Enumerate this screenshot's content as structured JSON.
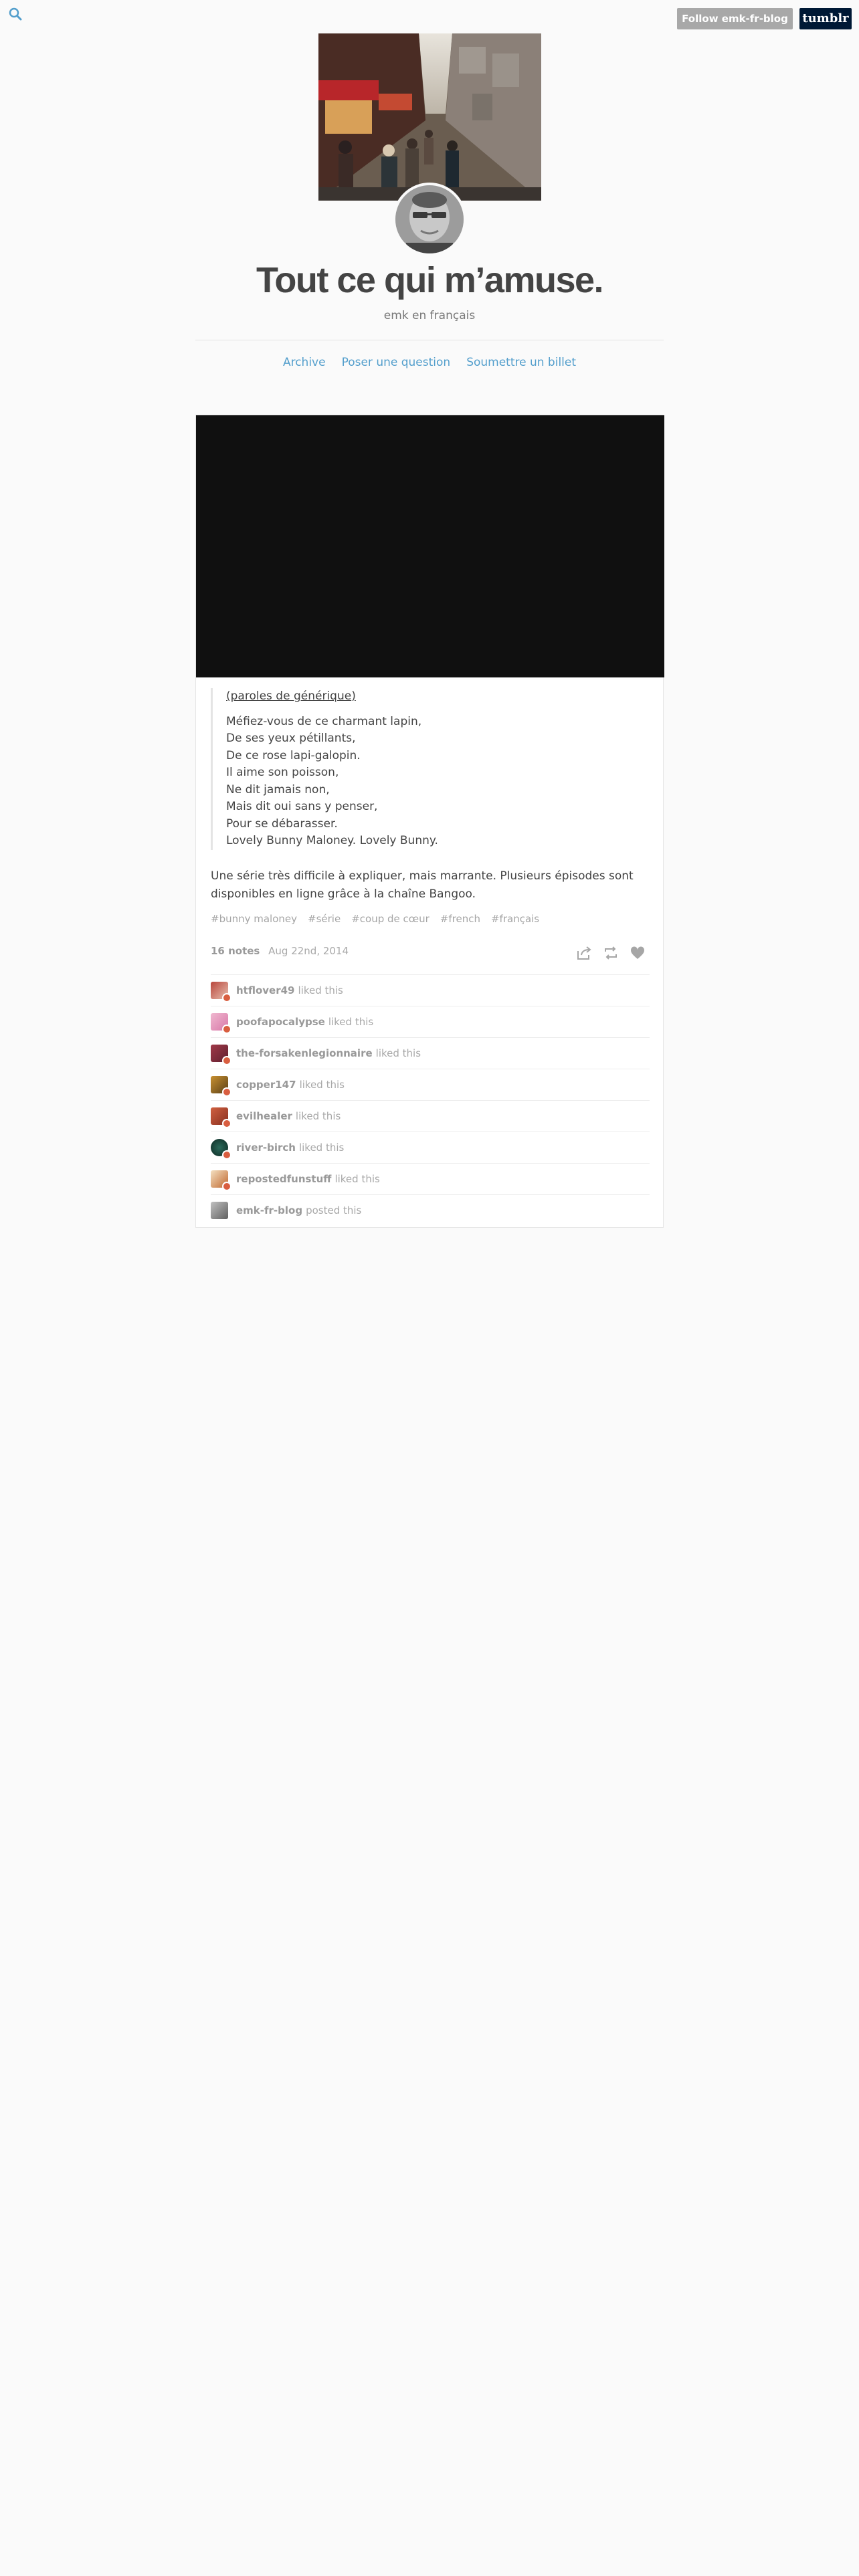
{
  "top": {
    "follow_label": "Follow emk-fr-blog",
    "tumblr_label": "tumblr"
  },
  "header": {
    "title": "Tout ce qui m’amuse.",
    "description": "emk en français"
  },
  "nav": {
    "items": [
      {
        "label": "Archive"
      },
      {
        "label": "Poser une question"
      },
      {
        "label": "Soumettre un billet"
      }
    ]
  },
  "post": {
    "quote_source": "paroles de générique",
    "quote_lines": [
      "Méfiez-vous de ce charmant lapin,",
      "De ses yeux pétillants,",
      "De ce rose lapi-galopin.",
      "Il aime son poisson,",
      "Ne dit jamais non,",
      "Mais dit oui sans y penser,",
      "Pour se débarasser.",
      "Lovely Bunny Maloney. Lovely Bunny."
    ],
    "body": "Une série très difficile à expliquer, mais marrante. Plusieurs épisodes sont disponibles en ligne grâce à la chaîne Bangoo.",
    "tags": [
      "#bunny maloney",
      "#série",
      "#coup de cœur",
      "#french",
      "#français"
    ],
    "notes_count": "16 notes",
    "date": "Aug 22nd, 2014",
    "notes": [
      {
        "user": "htflover49",
        "action": "liked this"
      },
      {
        "user": "poofapocalypse",
        "action": "liked this"
      },
      {
        "user": "the-forsakenlegionnaire",
        "action": "liked this"
      },
      {
        "user": "copper147",
        "action": "liked this"
      },
      {
        "user": "evilhealer",
        "action": "liked this"
      },
      {
        "user": "river-birch",
        "action": "liked this"
      },
      {
        "user": "repostedfunstuff",
        "action": "liked this"
      },
      {
        "user": "emk-fr-blog",
        "action": "posted this"
      }
    ]
  }
}
